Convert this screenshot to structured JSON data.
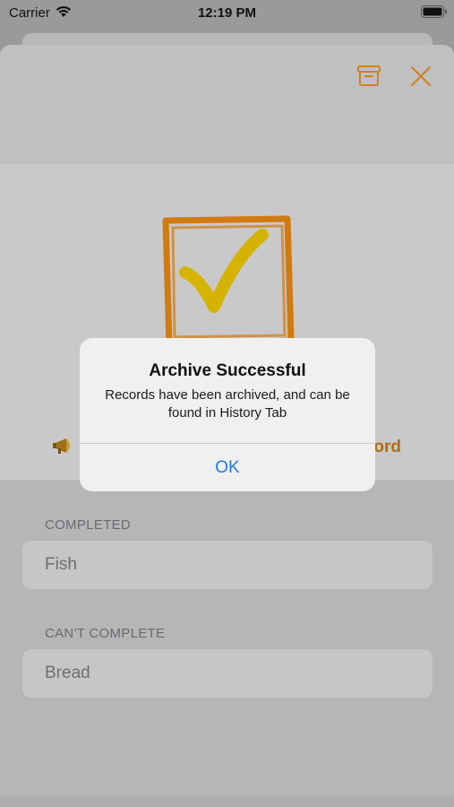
{
  "status_bar": {
    "carrier": "Carrier",
    "time": "12:19 PM"
  },
  "toolbar": {
    "archive_icon": "archive-box-icon",
    "close_icon": "close-x-icon",
    "accent_color": "#e08a1a"
  },
  "hero": {
    "illustration": "checked-box-illustration",
    "megaphone_icon": "megaphone-icon",
    "link_text": "ord"
  },
  "sections": {
    "completed": {
      "header": "COMPLETED",
      "items": [
        "Fish"
      ]
    },
    "cant_complete": {
      "header": "CAN'T COMPLETE",
      "items": [
        "Bread"
      ]
    }
  },
  "alert": {
    "title": "Archive Successful",
    "message": "Records have been archived, and can be found in History Tab",
    "ok_label": "OK",
    "ok_color": "#1b7ee0"
  }
}
